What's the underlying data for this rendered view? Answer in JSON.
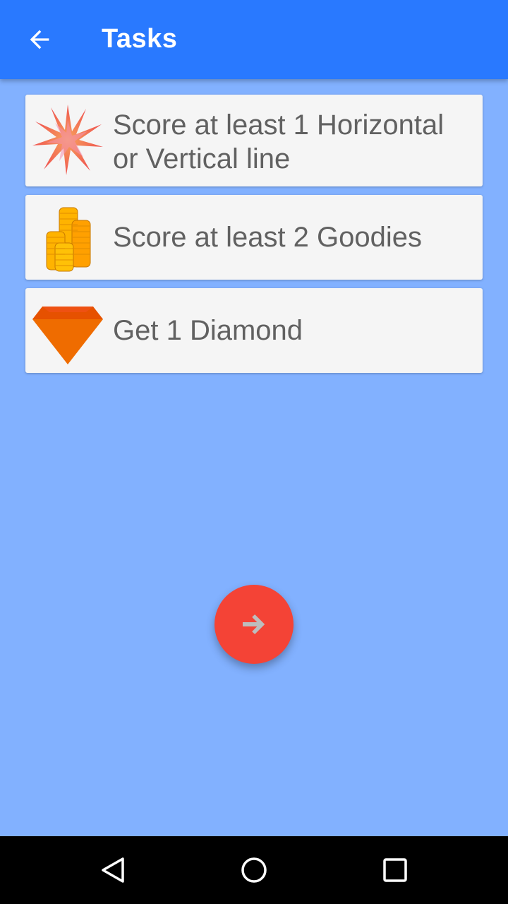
{
  "appbar": {
    "title": "Tasks",
    "back_icon": "arrow-left-icon"
  },
  "tasks": [
    {
      "icon": "starburst-icon",
      "label": "Score at least 1 Horizontal or Vertical line"
    },
    {
      "icon": "coin-stack-icon",
      "label": "Score at least 2 Goodies"
    },
    {
      "icon": "diamond-icon",
      "label": "Get 1 Diamond"
    }
  ],
  "fab": {
    "icon": "arrow-right-icon"
  },
  "navbar": {
    "back_icon": "nav-back-icon",
    "home_icon": "nav-home-icon",
    "recents_icon": "nav-recents-icon"
  },
  "colors": {
    "appbar": "#2979ff",
    "background": "#82b1ff",
    "card": "#f5f5f5",
    "text": "#616161",
    "fab": "#f44336"
  }
}
